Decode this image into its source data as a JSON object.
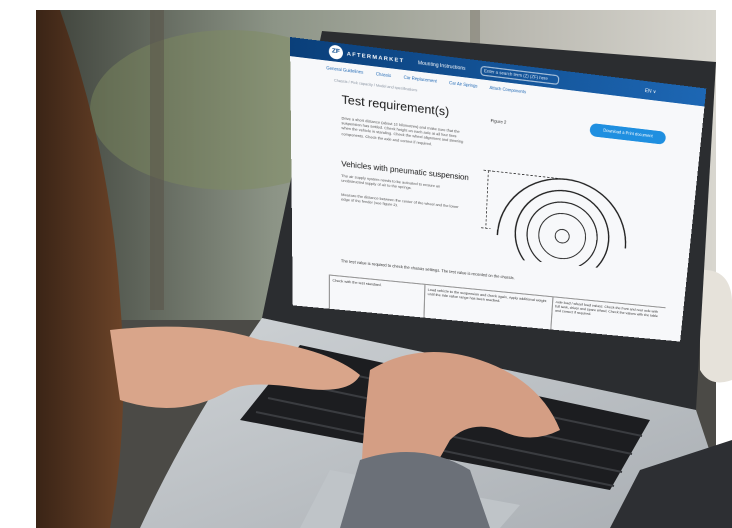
{
  "site": {
    "logo_text": "ZF",
    "brand": "AFTERMARKET",
    "nav_link": "Mounting Instructions",
    "search_text": "Enter a search term (Z) (ZF) here",
    "language": "EN ∨"
  },
  "tabs": [
    "General Guidelines",
    "Chassis",
    "Car Replacement",
    "Car Air Springs",
    "Attach Components"
  ],
  "breadcrumb": "Chassis  /  Pick capacity  /  Model and specifications",
  "content": {
    "heading": "Test requirement(s)",
    "intro": "Drive a short distance (about 10 kilometres) and make sure that the suspension has settled. Check height on each axle at all four tires when the vehicle is standing. Check the wheel alignment and steering components. Check the axle and correct if required.",
    "subheading": "Vehicles with pneumatic suspension",
    "sub_text": "The air supply system needs to be activated to ensure an unobstructed supply of air to the springs.",
    "sub_text2": "Measure the distance between the center of the wheel and the lower edge of the fender (see figure 2).",
    "figure_label": "Figure 2",
    "download_button": "Download a Print document",
    "table_note": "The test value is required to check the chassis settings. The test value is recorded on the chassis.",
    "table_cells": [
      "Check with the test standard.",
      "Load vehicle to the suspension and check again. Apply additional weight until the ride value range has been reached.",
      "Axle load / wheel load values: Check the front and rear axle with full tank, driver and spare wheel. Check the values with the table and correct if required."
    ]
  }
}
